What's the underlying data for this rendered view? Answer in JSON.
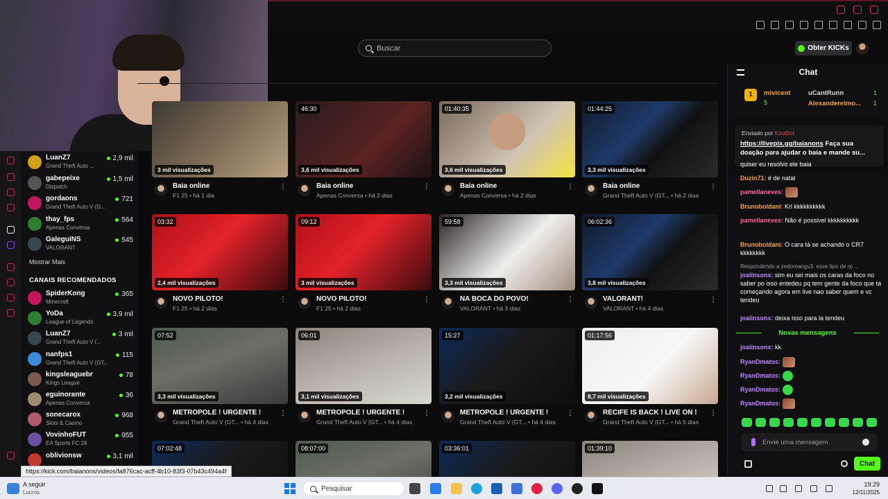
{
  "search": {
    "placeholder": "Buscar"
  },
  "header": {
    "get_kicks_label": "Obter KICKs"
  },
  "sidebar": {
    "following": [
      {
        "name": "LuanZ7",
        "game": "Grand Theft Auto ...",
        "viewers": "2,9 mil"
      },
      {
        "name": "gabepeixe",
        "game": "Dispatch",
        "viewers": "1,5 mil"
      },
      {
        "name": "gordaons",
        "game": "Grand Theft Auto V (G...",
        "viewers": "721"
      },
      {
        "name": "thay_fps",
        "game": "Apenas Conversa",
        "viewers": "564"
      },
      {
        "name": "GaleguiNS",
        "game": "VALORANT",
        "viewers": "545"
      }
    ],
    "show_more": "Mostrar Mais",
    "recommended_title": "CANAIS RECOMENDADOS",
    "recommended": [
      {
        "name": "SpiderKong",
        "game": "Minecraft",
        "viewers": "365"
      },
      {
        "name": "YoDa",
        "game": "League of Legends",
        "viewers": "3,9 mil"
      },
      {
        "name": "LuanZ7",
        "game": "Grand Theft Auto V (...",
        "viewers": "3 mil"
      },
      {
        "name": "nanfps1",
        "game": "Grand Theft Auto V (GT...",
        "viewers": "115"
      },
      {
        "name": "kingsleaguebr",
        "game": "Kings League",
        "viewers": "78"
      },
      {
        "name": "eguinorante",
        "game": "Apenas Conversa",
        "viewers": "36"
      },
      {
        "name": "sonecarox",
        "game": "Slots & Casino",
        "viewers": "968"
      },
      {
        "name": "VovinhoFUT",
        "game": "EA Sports FC 26",
        "viewers": "955"
      },
      {
        "name": "oblivionsw",
        "game": "",
        "viewers": "3,1 mil"
      }
    ]
  },
  "videos": [
    {
      "duration": "",
      "views": "3 mil visualizações",
      "title": "Baia online",
      "meta": "F1 25 • há 1 dia"
    },
    {
      "duration": "46:30",
      "views": "3,6 mil visualizações",
      "title": "Baia online",
      "meta": "Apenas Conversa • há 2 dias"
    },
    {
      "duration": "01:40:35",
      "views": "3,6 mil visualizações",
      "title": "Baia online",
      "meta": "Apenas Conversa • há 2 dias"
    },
    {
      "duration": "01:44:25",
      "views": "3,3 mil visualizações",
      "title": "Baia online",
      "meta": "Grand Theft Auto V (GT... • há 2 dias"
    },
    {
      "duration": "03:32",
      "views": "2,4 mil visualizações",
      "title": "NOVO PILOTO!",
      "meta": "F1 25 • há 2 dias"
    },
    {
      "duration": "09:12",
      "views": "3 mil visualizações",
      "title": "NOVO PILOTO!",
      "meta": "F1 25 • há 2 dias"
    },
    {
      "duration": "59:58",
      "views": "3,3 mil visualizações",
      "title": "NA BOCA DO POVO!",
      "meta": "VALORANT • há 3 dias"
    },
    {
      "duration": "06:02:36",
      "views": "3,8 mil visualizações",
      "title": "VALORANT!",
      "meta": "VALORANT • há 4 dias"
    },
    {
      "duration": "07:52",
      "views": "3,3 mil visualizações",
      "title": "METROPOLE ! URGENTE !",
      "meta": "Grand Theft Auto V (GT... • há 4 dias"
    },
    {
      "duration": "06:01",
      "views": "3,1 mil visualizações",
      "title": "METROPOLE ! URGENTE !",
      "meta": "Grand Theft Auto V (GT... • há 4 dias"
    },
    {
      "duration": "15:27",
      "views": "3,2 mil visualizações",
      "title": "METROPOLE ! URGENTE !",
      "meta": "Grand Theft Auto V (GT... • há 4 dias"
    },
    {
      "duration": "01:17:56",
      "views": "8,7 mil visualizações",
      "title": "RECIFE IS BACK ! LIVE ON !",
      "meta": "Grand Theft Auto V (GT... • há 5 dias"
    },
    {
      "duration": "07:02:48",
      "views": "",
      "title": "",
      "meta": ""
    },
    {
      "duration": "08:07:00",
      "views": "",
      "title": "",
      "meta": ""
    },
    {
      "duration": "03:36:01",
      "views": "",
      "title": "",
      "meta": ""
    },
    {
      "duration": "01:39:10",
      "views": "",
      "title": "",
      "meta": ""
    }
  ],
  "chat": {
    "title": "Chat",
    "gifters": {
      "rank": "1",
      "first": {
        "name": "mivicent",
        "count": "5"
      },
      "second": {
        "name": "uCantRunn",
        "count": "1"
      },
      "third": {
        "name": "Alexanderelmo...",
        "count": "1"
      }
    },
    "pinned": {
      "sent_by_label": "Enviado por",
      "sent_by_user": "KiraBot",
      "link": "https://livepix.gg/baianons",
      "text": " Faça sua doação para ajudar o baia e mande su..."
    },
    "messages": [
      {
        "user": "",
        "text": "quiser eu resolvo ele baia"
      },
      {
        "user": "Duzin71:",
        "text": " é de natal"
      },
      {
        "user": "pamellaneves:",
        "text": ""
      },
      {
        "user": "Brunoboldani:",
        "text": " Krl kkkkkkkkkk"
      },
      {
        "user": "pamellaneves:",
        "text": " Não é possivel kkkkkkkkkk"
      },
      {
        "user": "Brunoboldani:",
        "text": " O cara tá se achando o CR7 kkkkkkkk"
      },
      {
        "user": "joalinsonx:",
        "text": " sim eu sei mais os caras da foco no saber po isso entedeu pq tem gente da foco que ta começando agora em live nao saber quem e vc tendeu"
      },
      {
        "user": "joalinsonx:",
        "text": " deixa isso para la tendeu"
      },
      {
        "user": "joalinsonx:",
        "text": " kk"
      },
      {
        "user": "RyanDmatos:",
        "text": ""
      },
      {
        "user": "RyanDmatos:",
        "text": ""
      },
      {
        "user": "RyanDmatos:",
        "text": ""
      },
      {
        "user": "RyanDmatos:",
        "text": ""
      }
    ],
    "reply_context": "Respondendo a zedomangu3: esse tipo de rp ...",
    "new_messages_label": "Novas mensagens",
    "input_placeholder": "Envie uma mensagem",
    "send_label": "Chat"
  },
  "status_url": "https://kick.com/baianons/videos/fa876cac-acff-4b10-83f3-07b43c494a4f",
  "taskbar": {
    "weather_line1": "A seguir",
    "weather_line2": "Lucros",
    "search_label": "Pesquisar",
    "time": "19:29",
    "date": "12/11/2025"
  },
  "colors": {
    "accent": "#53fc18",
    "brand_pink": "#d6336c",
    "gold": "#f0b400"
  }
}
